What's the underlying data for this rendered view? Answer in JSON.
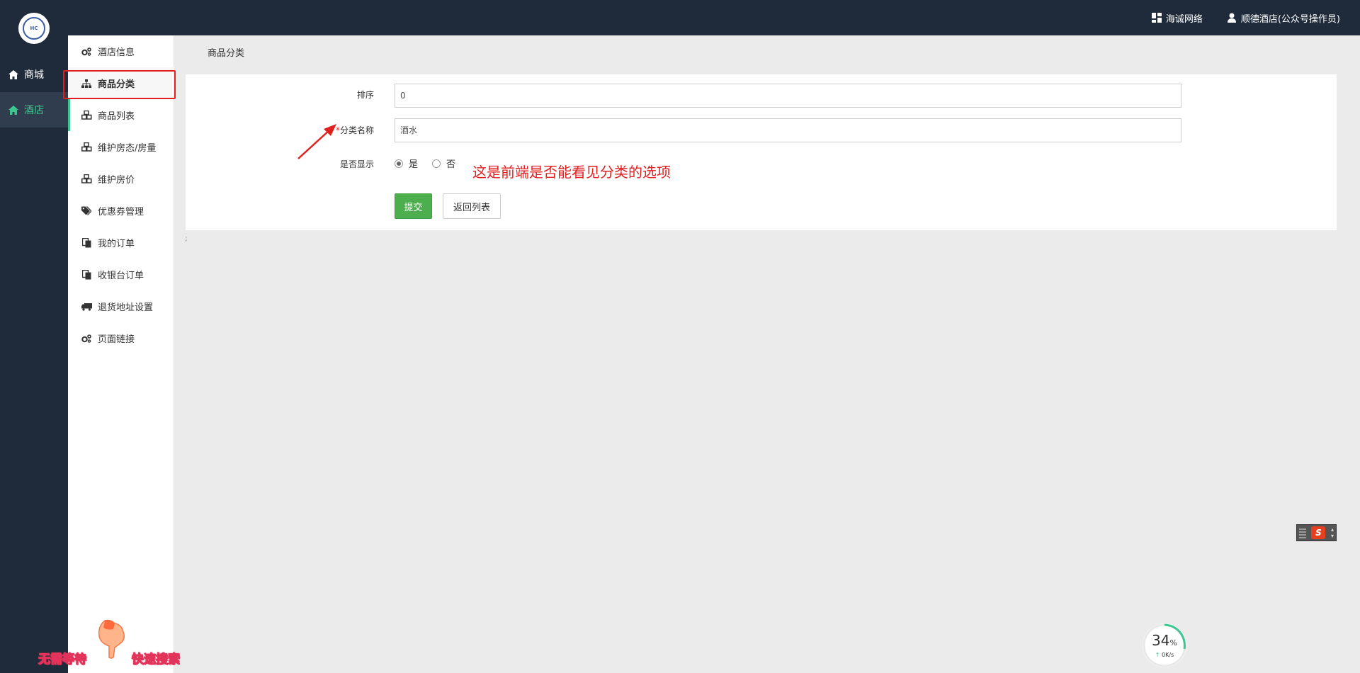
{
  "topbar": {
    "org_label": "海诚网络",
    "user_label": "顺德酒店(公众号操作员)"
  },
  "nav": {
    "logo_text": "HC",
    "items": [
      {
        "label": "商城",
        "icon": "home-icon",
        "active": false
      },
      {
        "label": "酒店",
        "icon": "home-icon",
        "active": true
      }
    ]
  },
  "subnav": {
    "items": [
      {
        "label": "酒店信息",
        "icon": "gears-icon",
        "active": false
      },
      {
        "label": "商品分类",
        "icon": "sitemap-icon",
        "active": true
      },
      {
        "label": "商品列表",
        "icon": "cubes-icon",
        "active": false
      },
      {
        "label": "维护房态/房量",
        "icon": "cubes-icon",
        "active": false
      },
      {
        "label": "维护房价",
        "icon": "cubes-icon",
        "active": false
      },
      {
        "label": "优惠券管理",
        "icon": "tags-icon",
        "active": false
      },
      {
        "label": "我的订单",
        "icon": "copy-icon",
        "active": false
      },
      {
        "label": "收银台订单",
        "icon": "copy-icon",
        "active": false
      },
      {
        "label": "退货地址设置",
        "icon": "truck-icon",
        "active": false
      },
      {
        "label": "页面链接",
        "icon": "gears-icon",
        "active": false
      }
    ]
  },
  "main": {
    "breadcrumb": "商品分类",
    "form": {
      "sort_label": "排序",
      "sort_value": "0",
      "name_required_mark": "*",
      "name_label": "分类名称",
      "name_value": "酒水",
      "visible_label": "是否显示",
      "visible_options": [
        "是",
        "否"
      ],
      "visible_selected": "是",
      "submit_label": "提交",
      "back_label": "返回列表"
    },
    "annotation": "这是前端是否能看见分类的选项",
    "stray_text": ";"
  },
  "widgets": {
    "ime_label": "S",
    "speed_percent": "34",
    "speed_percent_unit": "%",
    "speed_rate": "0K/s",
    "speed_arrow": "↑",
    "promo_left": "无需等待",
    "promo_right": "快速搜索"
  },
  "colors": {
    "nav_bg": "#1f2b3a",
    "accent": "#3ec68f",
    "primary_button": "#4cae4c",
    "annotation": "#e21f1f"
  }
}
